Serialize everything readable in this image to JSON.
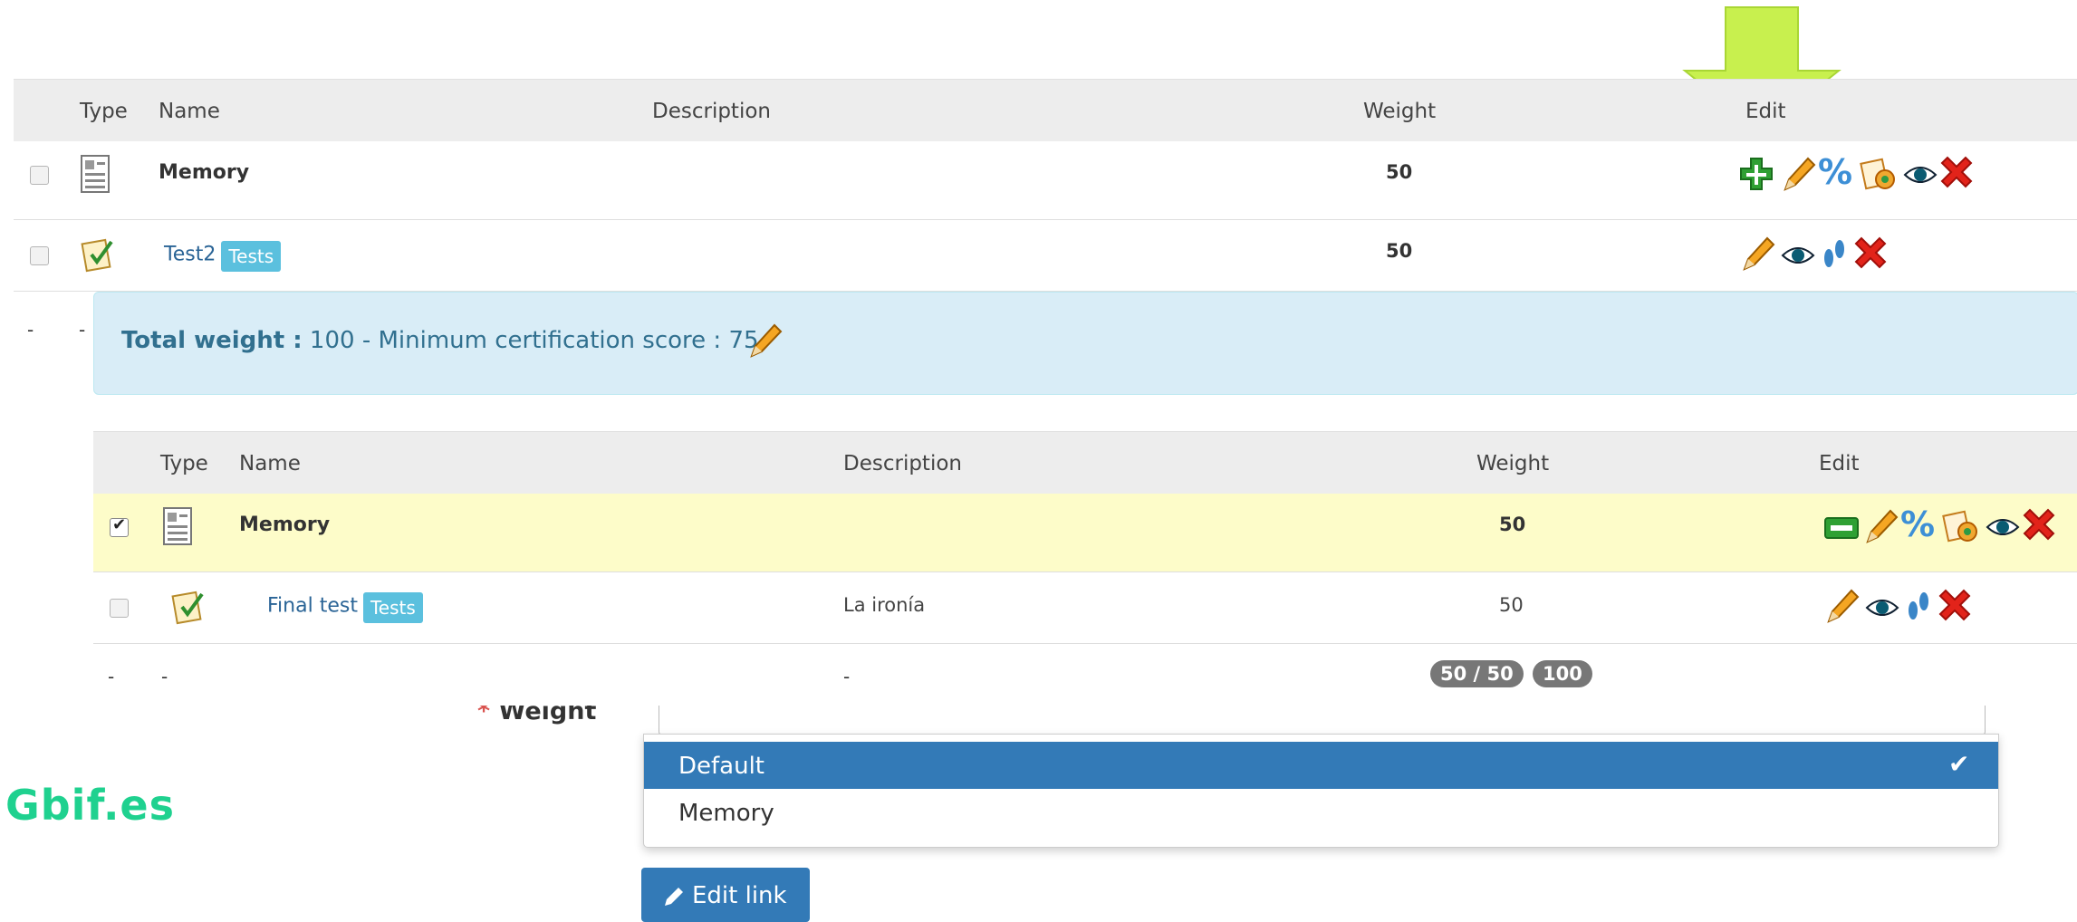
{
  "table1": {
    "headers": {
      "type": "Type",
      "name": "Name",
      "description": "Description",
      "weight": "Weight",
      "edit": "Edit"
    },
    "rows": [
      {
        "name": "Memory",
        "weight": "50"
      },
      {
        "name": "Test2",
        "tag": "Tests",
        "weight": "50"
      }
    ],
    "footer": {
      "type": "-",
      "name": "-"
    }
  },
  "summary": {
    "total_label": "Total weight :",
    "total_text": "100 - Minimum certification score : 75"
  },
  "table2": {
    "headers": {
      "type": "Type",
      "name": "Name",
      "description": "Description",
      "weight": "Weight",
      "edit": "Edit"
    },
    "rows": [
      {
        "name": "Memory",
        "weight": "50",
        "checked": true
      },
      {
        "name": "Final test",
        "tag": "Tests",
        "description": "La ironía",
        "weight": "50",
        "checked": false
      }
    ],
    "footer": {
      "type": "-",
      "name": "-",
      "description": "-",
      "badge_score": "50 / 50",
      "badge_total": "100"
    }
  },
  "form": {
    "weight_required": "*",
    "weight_label": "Weight",
    "dropdown_options": [
      "Default",
      "Memory"
    ],
    "selected": "Default",
    "edit_link_label": "Edit link"
  },
  "watermark": "Gbif.es",
  "colors": {
    "arrow": "#c8f04e",
    "highlight_row": "#fdfcc9",
    "info_box": "#d9edf7",
    "selected_option": "#337ab7",
    "brand": "#1fd18f"
  }
}
